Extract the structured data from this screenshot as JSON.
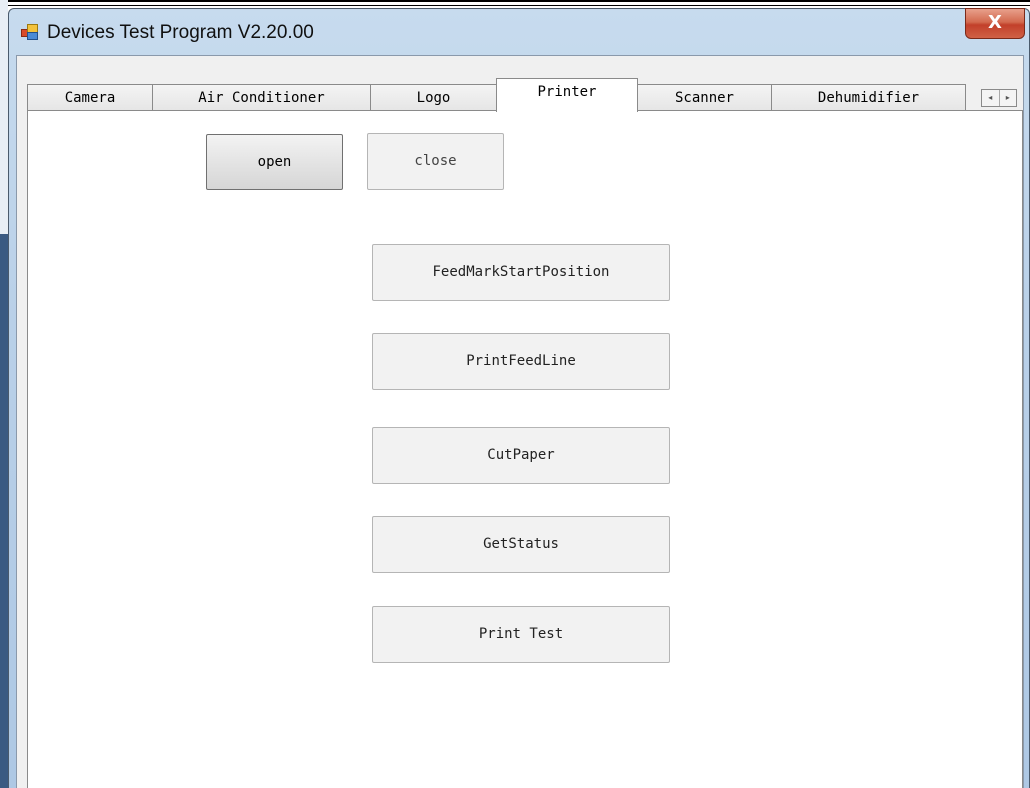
{
  "window": {
    "title": "Devices Test Program V2.20.00",
    "close_glyph": "X"
  },
  "tabs": [
    {
      "label": "Camera",
      "active": false
    },
    {
      "label": "Air Conditioner",
      "active": false
    },
    {
      "label": "Logo",
      "active": false
    },
    {
      "label": "Printer",
      "active": true
    },
    {
      "label": "Scanner",
      "active": false
    },
    {
      "label": "Dehumidifier",
      "active": false
    }
  ],
  "tab_scroll": {
    "left": "◂",
    "right": "▸"
  },
  "printer": {
    "open_label": "open",
    "close_label": "close",
    "buttons": [
      {
        "label": "FeedMarkStartPosition"
      },
      {
        "label": "PrintFeedLine"
      },
      {
        "label": "CutPaper"
      },
      {
        "label": "GetStatus"
      },
      {
        "label": "Print Test"
      }
    ]
  },
  "colors": {
    "close_button": "#c94a32",
    "titlebar": "#b9d0e8",
    "tab_page": "#ffffff"
  }
}
